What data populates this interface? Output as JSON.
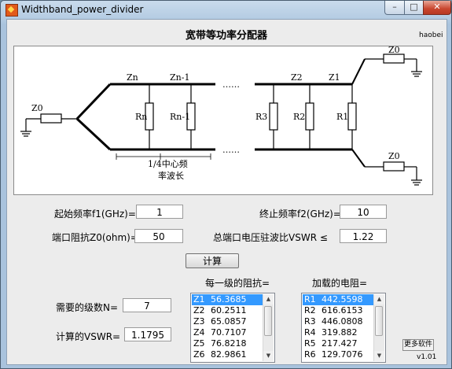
{
  "window": {
    "title": "Widthband_power_divider",
    "min": "–",
    "max": "□",
    "close": "✕"
  },
  "header": {
    "title": "宽带等功率分配器",
    "author": "haobei"
  },
  "diagram": {
    "labels": {
      "z0_left": "Z0",
      "zn": "Zn",
      "zn1": "Zn-1",
      "z2": "Z2",
      "z1": "Z1",
      "z0_top": "Z0",
      "z0_bottom": "Z0",
      "rn": "Rn",
      "rn1": "Rn-1",
      "r3": "R3",
      "r2": "R2",
      "r1": "R1",
      "dots": "……",
      "quarter_line1": "1/4中心频",
      "quarter_line2": "率波长"
    }
  },
  "form": {
    "f1_label": "起始频率f1(GHz)=",
    "f1_value": "1",
    "f2_label": "终止频率f2(GHz)=",
    "f2_value": "10",
    "z0_label": "端口阻抗Z0(ohm)=",
    "z0_value": "50",
    "vswr_label": "总端口电压驻波比VSWR ≤",
    "vswr_value": "1.22",
    "calc_button": "计算",
    "n_label": "需要的级数N=",
    "n_value": "7",
    "calc_vswr_label": "计算的VSWR=",
    "calc_vswr_value": "1.1795"
  },
  "impedance": {
    "title": "每一级的阻抗=",
    "rows": [
      {
        "k": "Z1",
        "v": "56.3685"
      },
      {
        "k": "Z2",
        "v": "60.2511"
      },
      {
        "k": "Z3",
        "v": "65.0857"
      },
      {
        "k": "Z4",
        "v": "70.7107"
      },
      {
        "k": "Z5",
        "v": "76.8218"
      },
      {
        "k": "Z6",
        "v": "82.9861"
      }
    ]
  },
  "resistor": {
    "title": "加载的电阻=",
    "rows": [
      {
        "k": "R1",
        "v": "442.5598"
      },
      {
        "k": "R2",
        "v": "616.6153"
      },
      {
        "k": "R3",
        "v": "446.0808"
      },
      {
        "k": "R4",
        "v": "319.882"
      },
      {
        "k": "R5",
        "v": "217.427"
      },
      {
        "k": "R6",
        "v": "129.7076"
      }
    ]
  },
  "footer": {
    "more_button": "更多软件",
    "version": "v1.01"
  },
  "colors": {
    "selection": "#3399ff",
    "close_button": "#c8462f"
  }
}
